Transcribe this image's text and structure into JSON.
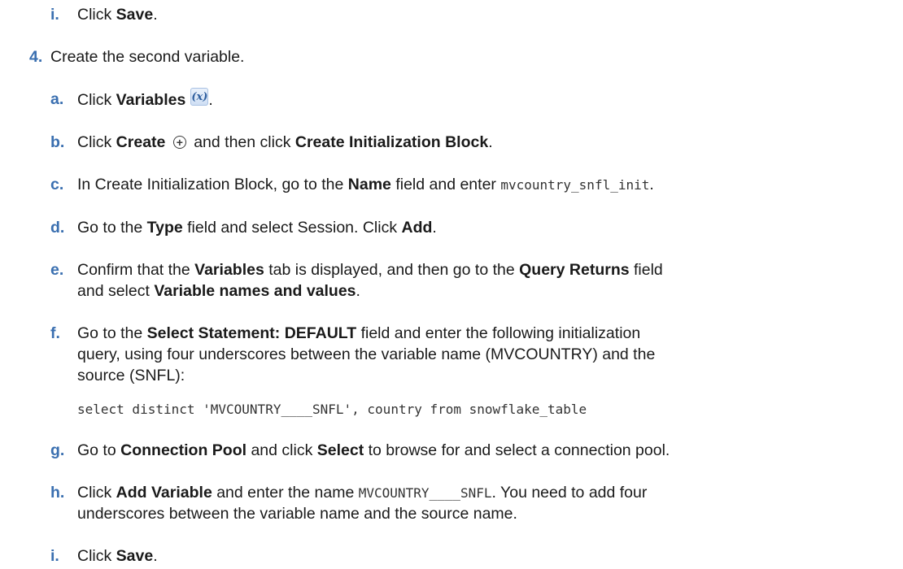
{
  "top_item": {
    "letter": "i.",
    "pre": "Click ",
    "bold": "Save",
    "post": "."
  },
  "step4": {
    "number": "4.",
    "text": "Create the second variable."
  },
  "sub": {
    "a": {
      "letter": "a.",
      "pre": "Click ",
      "bold": "Variables",
      "icon": "(x)",
      "post": "."
    },
    "b": {
      "letter": "b.",
      "pre": "Click ",
      "bold1": "Create",
      "icon": "+",
      "mid": " and then click ",
      "bold2": "Create Initialization Block",
      "post": "."
    },
    "c": {
      "letter": "c.",
      "pre": "In Create Initialization Block, go to the ",
      "bold": "Name",
      "mid": " field and enter ",
      "code": "mvcountry_snfl_init",
      "post": "."
    },
    "d": {
      "letter": "d.",
      "pre": "Go to the ",
      "bold1": "Type",
      "mid": " field and select Session. Click ",
      "bold2": "Add",
      "post": "."
    },
    "e": {
      "letter": "e.",
      "line1_pre": "Confirm that the ",
      "bold1": "Variables",
      "line1_mid": " tab is displayed, and then go to the ",
      "bold2": "Query Returns",
      "line1_post": " field",
      "line2_pre": "and select ",
      "bold3": "Variable names and values",
      "line2_post": "."
    },
    "f": {
      "letter": "f.",
      "line1_pre": "Go to the ",
      "bold1": "Select Statement: DEFAULT",
      "line1_post": " field and enter the following initialization",
      "line2": "query, using four underscores between the variable name (MVCOUNTRY) and the",
      "line3": "source (SNFL):",
      "code": "select distinct 'MVCOUNTRY____SNFL', country from snowflake_table"
    },
    "g": {
      "letter": "g.",
      "pre": "Go to ",
      "bold1": "Connection Pool",
      "mid": " and click ",
      "bold2": "Select",
      "post": " to browse for and select a connection pool."
    },
    "h": {
      "letter": "h.",
      "pre": "Click ",
      "bold": "Add Variable",
      "mid": " and enter the name ",
      "code": "MVCOUNTRY____SNFL",
      "line1_post": ". You need to add four",
      "line2": "underscores between the variable name and the source name."
    },
    "i": {
      "letter": "i.",
      "pre": "Click ",
      "bold": "Save",
      "post": "."
    }
  }
}
